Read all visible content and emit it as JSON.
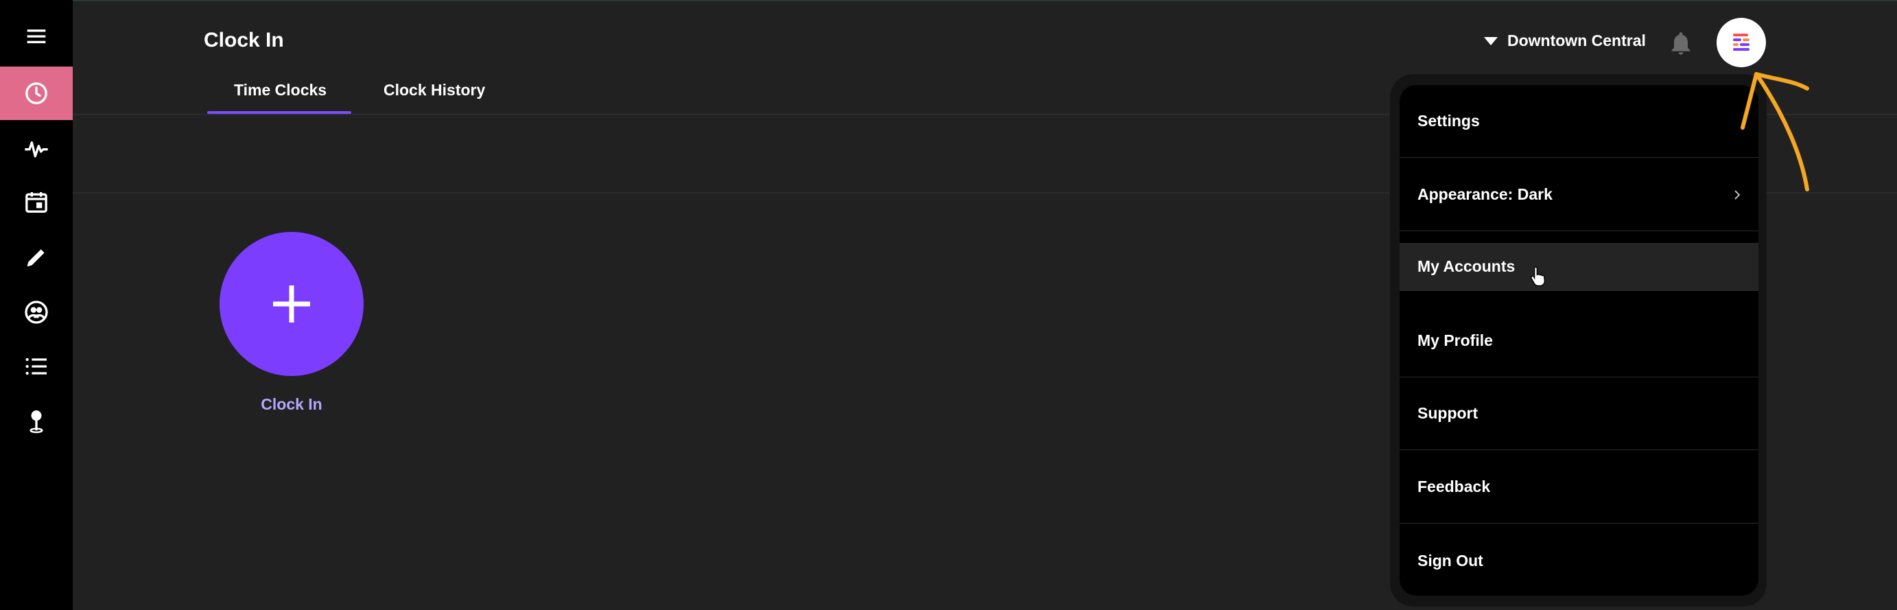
{
  "header": {
    "title": "Clock In",
    "location": "Downtown Central"
  },
  "tabs": [
    {
      "label": "Time Clocks",
      "active": true
    },
    {
      "label": "Clock History",
      "active": false
    }
  ],
  "sidebar": {
    "items": [
      {
        "icon": "menu-icon"
      },
      {
        "icon": "clock-icon",
        "active": true
      },
      {
        "icon": "pulse-icon"
      },
      {
        "icon": "calendar-icon"
      },
      {
        "icon": "pencil-icon"
      },
      {
        "icon": "team-icon"
      },
      {
        "icon": "list-icon"
      },
      {
        "icon": "location-pin-icon"
      }
    ]
  },
  "main": {
    "clock_in_label": "Clock In"
  },
  "user_menu": {
    "items": [
      {
        "label": "Settings"
      },
      {
        "label": "Appearance: Dark",
        "has_submenu": true
      },
      {
        "label": "My Accounts",
        "hovered": true
      },
      {
        "label": "My Profile"
      },
      {
        "label": "Support"
      },
      {
        "label": "Feedback"
      },
      {
        "label": "Sign Out"
      }
    ]
  },
  "colors": {
    "accent": "#7c3dff",
    "active_nav": "#e06b8b",
    "annotation": "#f5a623"
  }
}
